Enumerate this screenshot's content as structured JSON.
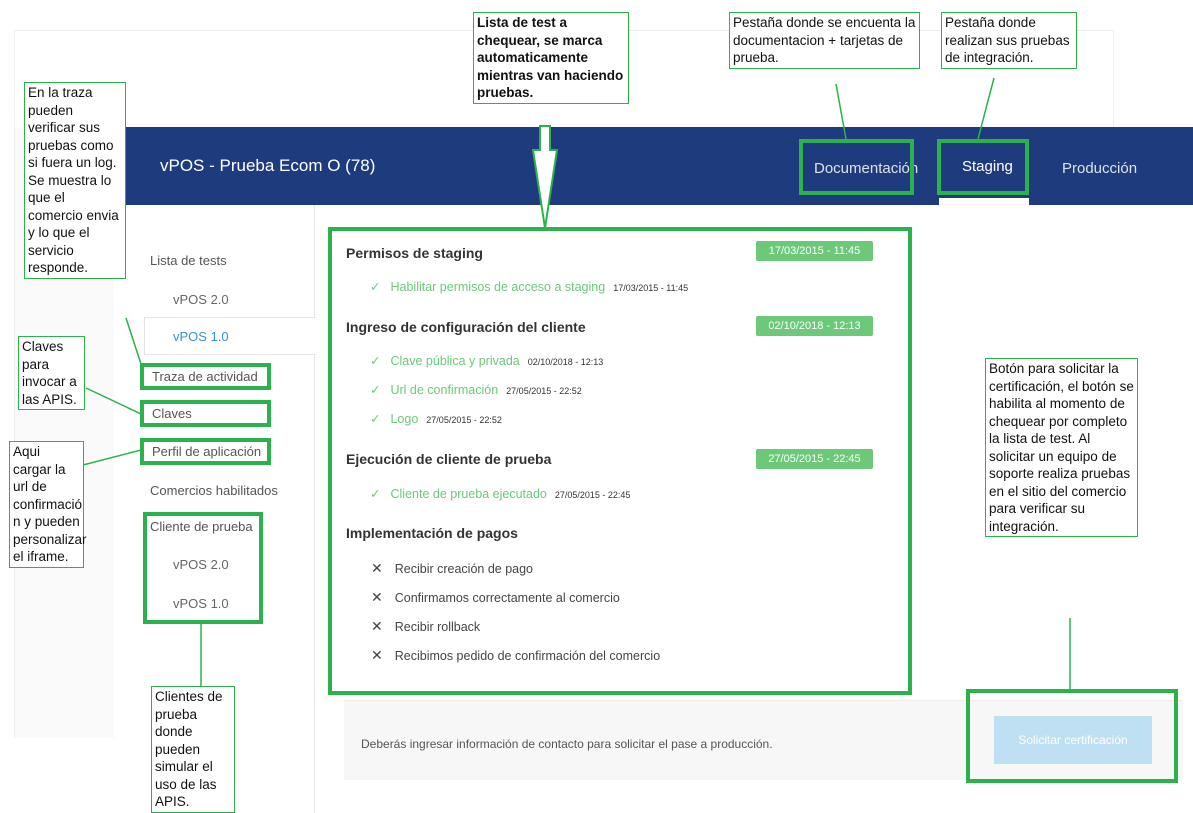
{
  "app": {
    "title": "vPOS - Prueba Ecom O (78)",
    "tabs": [
      {
        "label": "Documentación",
        "active": false
      },
      {
        "label": "Staging",
        "active": true
      },
      {
        "label": "Producción",
        "active": false
      }
    ]
  },
  "sidebar": {
    "header": "Lista de tests",
    "items": [
      "vPOS 2.0",
      "vPOS 1.0",
      "Traza de actividad",
      "Claves",
      "Perfil de aplicación",
      "Comercios habilitados",
      "Cliente de prueba"
    ],
    "sub_items": [
      "vPOS 2.0",
      "vPOS 1.0"
    ]
  },
  "checklist": {
    "sections": [
      {
        "title": "Permisos de staging",
        "badge": "17/03/2015 - 11:45",
        "items": [
          {
            "mark": "✓",
            "label": "Habilitar permisos de acceso a staging",
            "ts": "17/03/2015 - 11:45"
          }
        ]
      },
      {
        "title": "Ingreso de configuración del cliente",
        "badge": "02/10/2018 - 12:13",
        "items": [
          {
            "mark": "✓",
            "label": "Clave pública y privada",
            "ts": "02/10/2018 - 12:13"
          },
          {
            "mark": "✓",
            "label": "Url de confirmación",
            "ts": "27/05/2015 - 22:52"
          },
          {
            "mark": "✓",
            "label": "Logo",
            "ts": "27/05/2015 - 22:52"
          }
        ]
      },
      {
        "title": "Ejecución de cliente de prueba",
        "badge": "27/05/2015 - 22:45",
        "items": [
          {
            "mark": "✓",
            "label": "Cliente de prueba ejecutado",
            "ts": "27/05/2015 - 22:45"
          }
        ]
      },
      {
        "title": "Implementación de pagos",
        "items": [
          {
            "mark": "✕",
            "label": "Recibir creación de pago"
          },
          {
            "mark": "✕",
            "label": "Confirmamos correctamente al comercio"
          },
          {
            "mark": "✕",
            "label": "Recibir rollback"
          },
          {
            "mark": "✕",
            "label": "Recibimos pedido de confirmación del comercio"
          }
        ]
      }
    ]
  },
  "footer": {
    "text": "Deberás ingresar información de contacto para solicitar el pase a producción.",
    "button": "Solicitar certificación"
  },
  "annotations": {
    "lista_tests": "Lista de test a chequear, se marca automaticamente mientras van haciendo pruebas.",
    "documentacion": "Pestaña donde se encuenta la documentacion + tarjetas de prueba.",
    "staging": "Pestaña donde realizan sus pruebas de integración.",
    "traza": "En la traza pueden verificar sus pruebas como si fuera un log. Se muestra lo que el comercio envia y lo que el servicio responde.",
    "claves": "Claves para invocar a las APIS.",
    "perfil": "Aqui cargar la url de confirmació n y pueden personalizar el iframe.",
    "clientes": "Clientes de prueba donde pueden simular el uso de las APIS.",
    "boton": "Botón para solicitar la certificación, el botón se habilita al momento de chequear por completo la lista de test. Al solicitar un equipo de soporte realiza pruebas en el sitio del comercio para verificar su integración."
  },
  "colors": {
    "navbar": "#1e3b7e",
    "accent_green": "#6cc97a",
    "annotation_green": "#2bb24c",
    "button_disabled": "#bfe0f2"
  }
}
